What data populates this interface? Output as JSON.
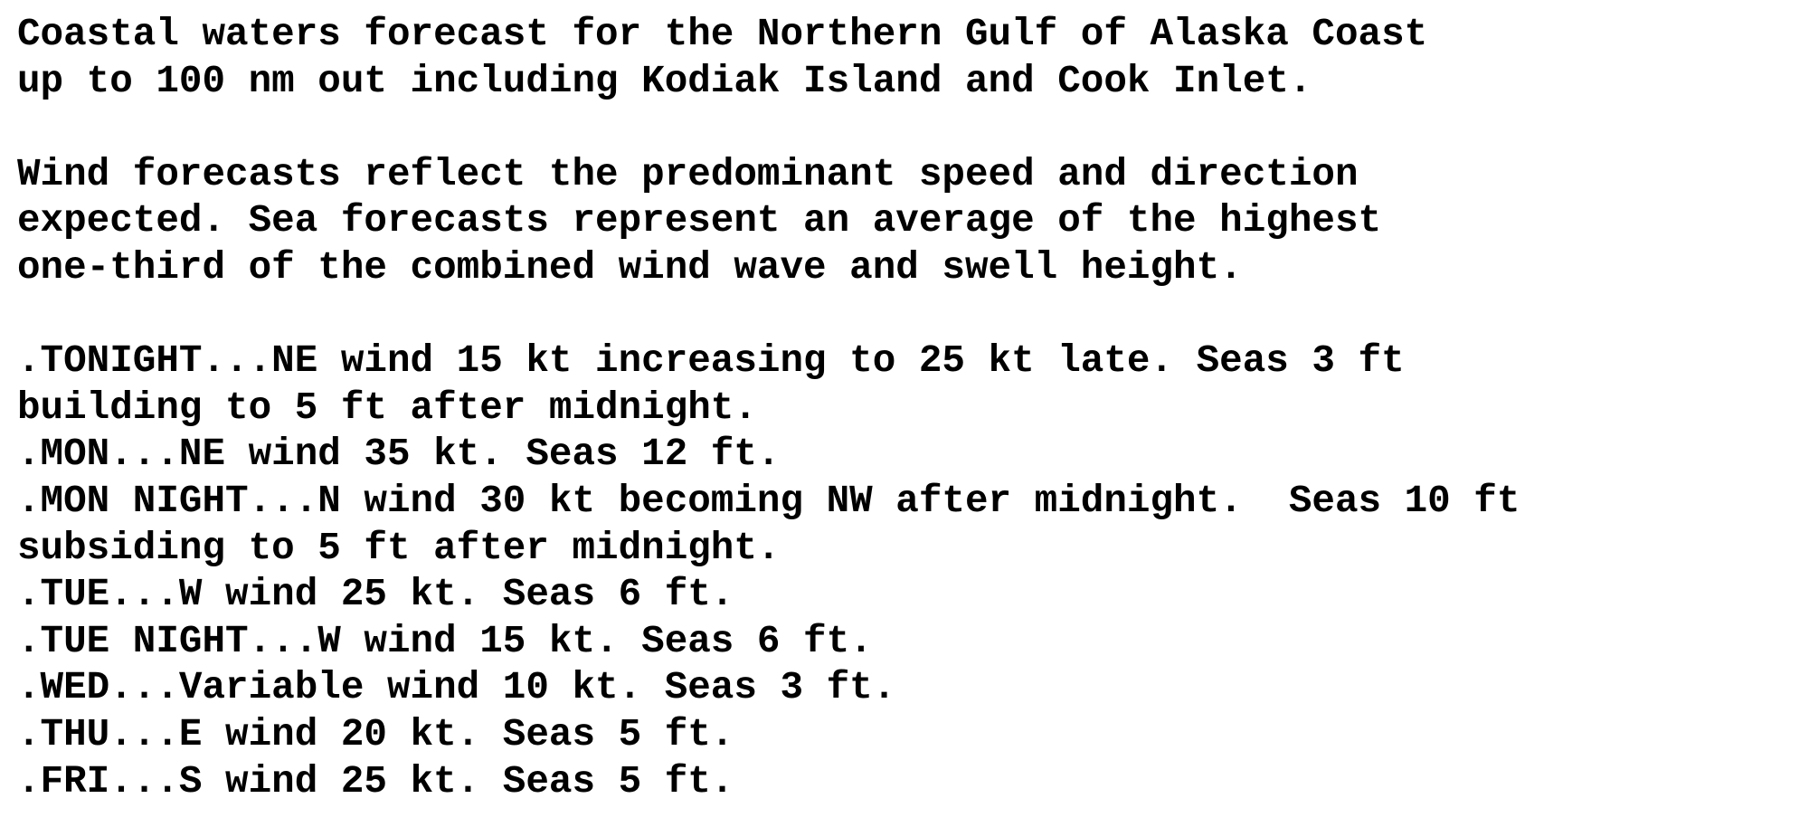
{
  "document": {
    "intro": [
      "Coastal waters forecast for the Northern Gulf of Alaska Coast",
      "up to 100 nm out including Kodiak Island and Cook Inlet."
    ],
    "disclaimer": [
      "Wind forecasts reflect the predominant speed and direction",
      "expected. Sea forecasts represent an average of the highest",
      "one-third of the combined wind wave and swell height."
    ],
    "periods": [
      {
        "lines": [
          ".TONIGHT...NE wind 15 kt increasing to 25 kt late. Seas 3 ft",
          "building to 5 ft after midnight."
        ]
      },
      {
        "lines": [
          ".MON...NE wind 35 kt. Seas 12 ft."
        ]
      },
      {
        "lines": [
          ".MON NIGHT...N wind 30 kt becoming NW after midnight.  Seas 10 ft",
          "subsiding to 5 ft after midnight."
        ]
      },
      {
        "lines": [
          ".TUE...W wind 25 kt. Seas 6 ft."
        ]
      },
      {
        "lines": [
          ".TUE NIGHT...W wind 15 kt. Seas 6 ft."
        ]
      },
      {
        "lines": [
          ".WED...Variable wind 10 kt. Seas 3 ft."
        ]
      },
      {
        "lines": [
          ".THU...E wind 20 kt. Seas 5 ft."
        ]
      },
      {
        "lines": [
          ".FRI...S wind 25 kt. Seas 5 ft."
        ]
      }
    ]
  }
}
